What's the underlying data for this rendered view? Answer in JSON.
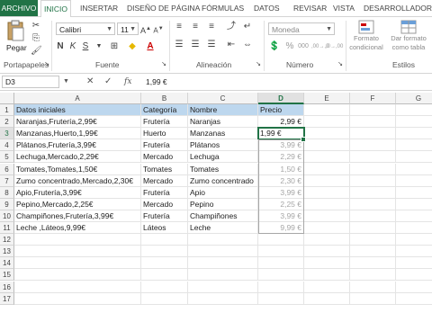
{
  "tabs": [
    "ARCHIVO",
    "INICIO",
    "INSERTAR",
    "DISEÑO DE PÁGINA",
    "FÓRMULAS",
    "DATOS",
    "REVISAR",
    "VISTA",
    "DESARROLLADOR"
  ],
  "ribbon": {
    "paste_label": "Pegar",
    "font_name": "Calibri",
    "font_size": "11",
    "number_format": "Moneda",
    "bold": "N",
    "italic": "K",
    "underline": "S",
    "conditional_format": "Formato condicional",
    "format_as_table": "Dar formato como tabla",
    "groups": [
      "Portapapeles",
      "Fuente",
      "Alineación",
      "Número",
      "Estilos"
    ],
    "percent": "%",
    "thousands": "000",
    "dec_inc": ",00→,0",
    "dec_dec": ",0→,00"
  },
  "formula_bar": {
    "name_box": "D3",
    "fx": "fx",
    "value": "1,99 €"
  },
  "columns": [
    "A",
    "B",
    "C",
    "D",
    "E",
    "F",
    "G"
  ],
  "rows": [
    "1",
    "2",
    "3",
    "4",
    "5",
    "6",
    "7",
    "8",
    "9",
    "10",
    "11",
    "12",
    "13",
    "14",
    "15",
    "16",
    "17"
  ],
  "headers": {
    "a": "Datos iniciales",
    "b": "Categoría",
    "c": "Nombre",
    "d": "Precio"
  },
  "data": [
    {
      "a": "Naranjas,Frutería,2,99€",
      "b": "Frutería",
      "c": "Naranjas",
      "d": "2,99 €"
    },
    {
      "a": "Manzanas,Huerto,1,99€",
      "b": "Huerto",
      "c": "Manzanas",
      "d": "1,99 €"
    },
    {
      "a": "Plátanos,Frutería,3,99€",
      "b": "Frutería",
      "c": "Plátanos",
      "d": "3,99 €"
    },
    {
      "a": "Lechuga,Mercado,2,29€",
      "b": "Mercado",
      "c": "Lechuga",
      "d": "2,29 €"
    },
    {
      "a": "Tomates,Tomates,1,50€",
      "b": "Tomates",
      "c": "Tomates",
      "d": "1,50 €"
    },
    {
      "a": "Zumo concentrado,Mercado,2,30€",
      "b": "Mercado",
      "c": "Zumo concentrado",
      "d": "2,30 €"
    },
    {
      "a": "Apio,Frutería,3,99€",
      "b": "Frutería",
      "c": "Apio",
      "d": "3,99 €"
    },
    {
      "a": "Pepino,Mercado,2,25€",
      "b": "Mercado",
      "c": "Pepino",
      "d": "2,25 €"
    },
    {
      "a": "Champiñones,Frutería,3,99€",
      "b": "Frutería",
      "c": "Champiñones",
      "d": "3,99 €"
    },
    {
      "a": "Leche ,Láteos,9,99€",
      "b": "Láteos",
      "c": "Leche",
      "d": "9,99 €"
    }
  ],
  "colors": {
    "accent": "#217346",
    "header_fill": "#bdd7ee",
    "ghost_text": "#a6a6a6"
  }
}
